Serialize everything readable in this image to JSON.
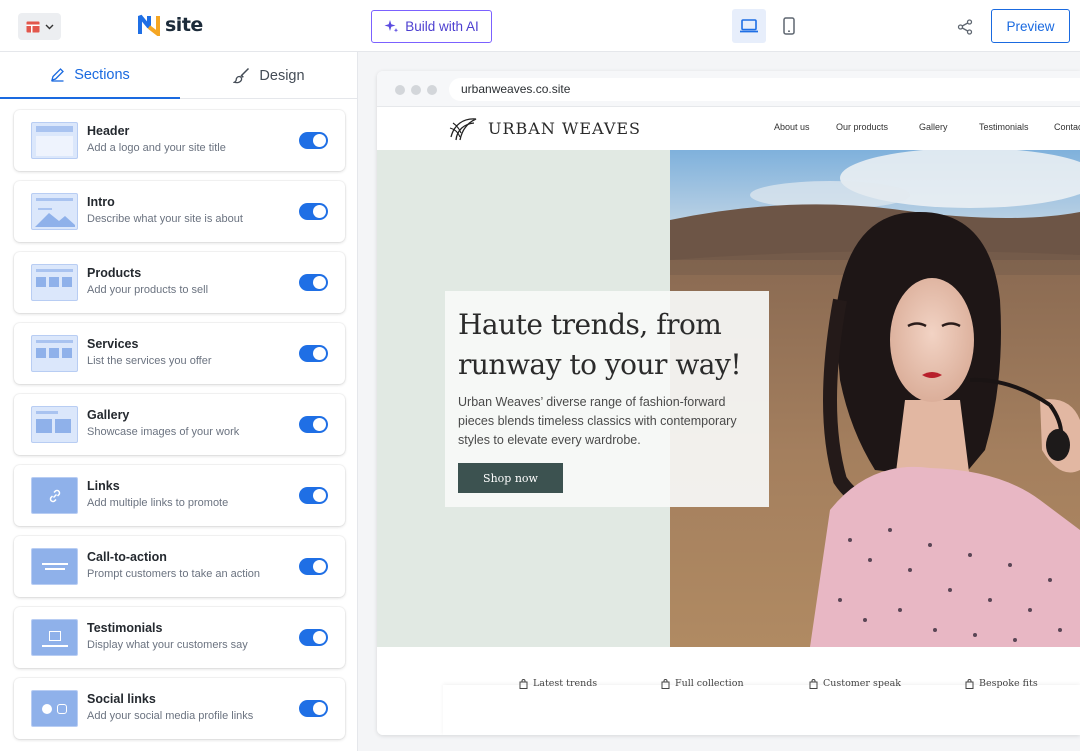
{
  "topbar": {
    "logo_text": "site",
    "ai_button": "Build with AI",
    "preview_button": "Preview"
  },
  "sidebar": {
    "tabs": [
      {
        "label": "Sections"
      },
      {
        "label": "Design"
      }
    ],
    "sections": [
      {
        "title": "Header",
        "desc": "Add a logo and your site title",
        "enabled": true
      },
      {
        "title": "Intro",
        "desc": "Describe what your site is about",
        "enabled": true
      },
      {
        "title": "Products",
        "desc": "Add your products to sell",
        "enabled": true
      },
      {
        "title": "Services",
        "desc": "List the services you offer",
        "enabled": true
      },
      {
        "title": "Gallery",
        "desc": "Showcase images of your work",
        "enabled": true
      },
      {
        "title": "Links",
        "desc": "Add multiple links to promote",
        "enabled": true
      },
      {
        "title": "Call-to-action",
        "desc": "Prompt customers to take an action",
        "enabled": true
      },
      {
        "title": "Testimonials",
        "desc": "Display what your customers say",
        "enabled": true
      },
      {
        "title": "Social links",
        "desc": "Add your social media profile links",
        "enabled": true
      }
    ]
  },
  "preview": {
    "url": "urbanweaves.co.site",
    "brand": "URBAN WEAVES",
    "nav": [
      "About us",
      "Our products",
      "Gallery",
      "Testimonials",
      "Contac"
    ],
    "hero_title": "Haute trends, from runway to your way!",
    "hero_text": "Urban Weaves’ diverse range of fashion-forward pieces blends timeless classics with contemporary styles to elevate every wardrobe.",
    "hero_button": "Shop now",
    "features": [
      "Latest trends",
      "Full collection",
      "Customer speak",
      "Bespoke fits"
    ]
  },
  "colors": {
    "accent": "#1a6ae0",
    "ai": "#7b61ff",
    "toggle_on": "#1f6fe5",
    "hero_bg": "#e1e9e3",
    "cta": "#3c5250"
  }
}
